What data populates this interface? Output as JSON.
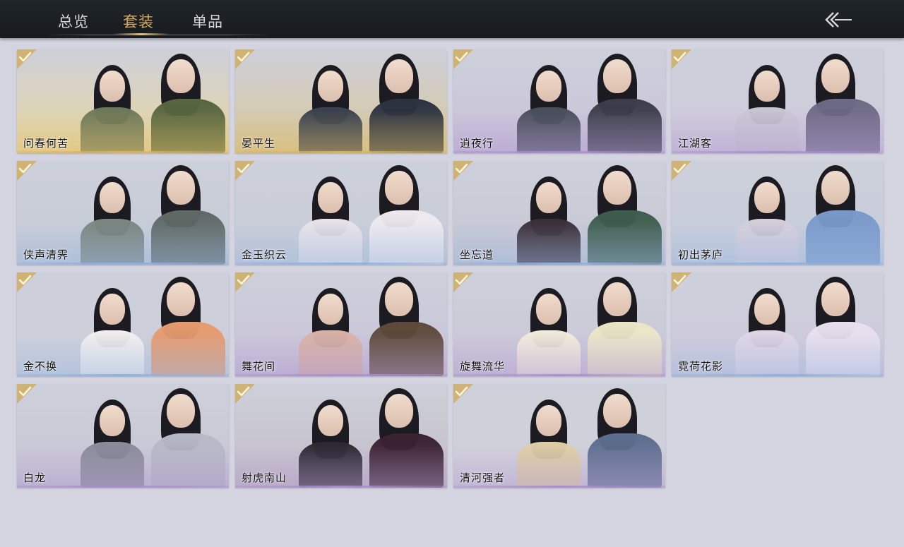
{
  "header": {
    "tabs": [
      {
        "label": "总览",
        "active": false
      },
      {
        "label": "套装",
        "active": true
      },
      {
        "label": "单品",
        "active": false
      }
    ],
    "back_icon": "double-chevron-left-arrow-icon",
    "accent_color": "#d6ab5e"
  },
  "outfits": [
    {
      "name": "问春何苦",
      "owned": true,
      "rarity": "gold"
    },
    {
      "name": "晏平生",
      "owned": true,
      "rarity": "gold"
    },
    {
      "name": "逍夜行",
      "owned": true,
      "rarity": "purple"
    },
    {
      "name": "江湖客",
      "owned": true,
      "rarity": "purple"
    },
    {
      "name": "侠声清霁",
      "owned": true,
      "rarity": "blue"
    },
    {
      "name": "金玉织云",
      "owned": true,
      "rarity": "blue"
    },
    {
      "name": "坐忘道",
      "owned": true,
      "rarity": "blue"
    },
    {
      "name": "初出茅庐",
      "owned": true,
      "rarity": "blue"
    },
    {
      "name": "金不换",
      "owned": true,
      "rarity": "blue"
    },
    {
      "name": "舞花间",
      "owned": true,
      "rarity": "purple"
    },
    {
      "name": "旋舞流华",
      "owned": true,
      "rarity": "purple"
    },
    {
      "name": "霓荷花影",
      "owned": true,
      "rarity": "blue"
    },
    {
      "name": "白龙",
      "owned": true,
      "rarity": "purple"
    },
    {
      "name": "射虎南山",
      "owned": true,
      "rarity": "purple"
    },
    {
      "name": "清河强者",
      "owned": true,
      "rarity": "purple"
    }
  ],
  "rarity_colors": {
    "gold": "#d8b45a",
    "purple": "#a98fcf",
    "blue": "#8fb0df"
  },
  "check_icon": "gold-checkmark-icon"
}
